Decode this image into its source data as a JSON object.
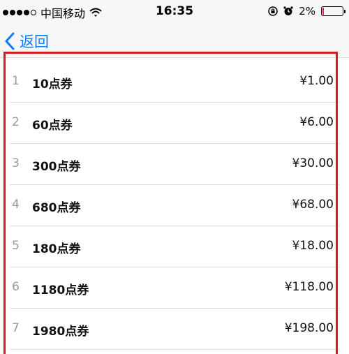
{
  "status_bar": {
    "carrier": "中国移动",
    "time": "16:35",
    "battery_percent": "2%",
    "battery_level": 0.02
  },
  "nav": {
    "back_label": "返回"
  },
  "list": {
    "items": [
      {
        "index": "1",
        "name": "10点券",
        "price": "¥1.00"
      },
      {
        "index": "2",
        "name": "60点券",
        "price": "¥6.00"
      },
      {
        "index": "3",
        "name": "300点券",
        "price": "¥30.00"
      },
      {
        "index": "4",
        "name": "680点券",
        "price": "¥68.00"
      },
      {
        "index": "5",
        "name": "180点券",
        "price": "¥18.00"
      },
      {
        "index": "6",
        "name": "1180点券",
        "price": "¥118.00"
      },
      {
        "index": "7",
        "name": "1980点券",
        "price": "¥198.00"
      }
    ]
  },
  "colors": {
    "accent": "#0a7aff",
    "highlight": "#d8192a",
    "battery_low": "#d32f2f"
  },
  "icons": {
    "signal": "signal-dots-icon",
    "wifi": "wifi-icon",
    "rotation_lock": "rotation-lock-icon",
    "alarm": "alarm-icon",
    "battery": "battery-icon",
    "back": "chevron-left-icon"
  }
}
